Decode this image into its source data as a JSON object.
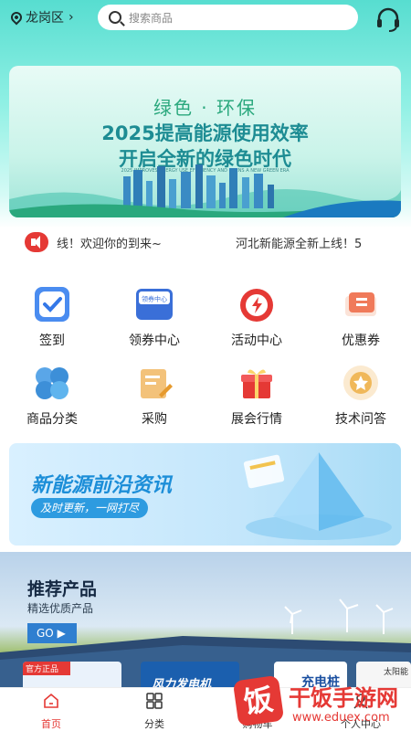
{
  "header": {
    "location": "龙岗区",
    "search_placeholder": "搜索商品"
  },
  "banner": {
    "line1": "绿色 · 环保",
    "line2": "2025提高能源使用效率",
    "line3": "开启全新的绿色时代",
    "line4": "2025 IMPROVES ENERGY USE EFFICIENCY AND OPENS A NEW GREEN ERA"
  },
  "notice": {
    "text1": "线！欢迎你的到来~",
    "text2": "河北新能源全新上线！5"
  },
  "grid": [
    {
      "label": "签到",
      "icon": "checkin-icon"
    },
    {
      "label": "领券中心",
      "icon": "coupon-center-icon",
      "tag": "领券中心"
    },
    {
      "label": "活动中心",
      "icon": "alarm-clock-icon"
    },
    {
      "label": "优惠券",
      "icon": "ticket-icon"
    },
    {
      "label": "商品分类",
      "icon": "category-bubbles-icon"
    },
    {
      "label": "采购",
      "icon": "purchase-icon"
    },
    {
      "label": "展会行情",
      "icon": "gift-box-icon"
    },
    {
      "label": "技术问答",
      "icon": "medal-icon"
    }
  ],
  "promo": {
    "title": "新能源前沿资讯",
    "subtitle": "及时更新，一网打尽"
  },
  "recommend": {
    "title": "推荐产品",
    "subtitle": "精选优质产品",
    "button": "GO",
    "card1_badge": "官方正品",
    "card2_text": "风力发电机",
    "card3_text": "充电桩",
    "card4_text": "太阳能"
  },
  "tabbar": [
    {
      "label": "首页",
      "active": true
    },
    {
      "label": "分类",
      "active": false
    },
    {
      "label": "购物车",
      "active": false
    },
    {
      "label": "个人中心",
      "active": false
    }
  ],
  "watermark": {
    "logo_char": "饭",
    "name": "干饭手游网",
    "url": "www.eduex.com"
  },
  "colors": {
    "accent": "#e53935",
    "teal": "#57ddd0",
    "promo_blue": "#1c8ed8"
  }
}
